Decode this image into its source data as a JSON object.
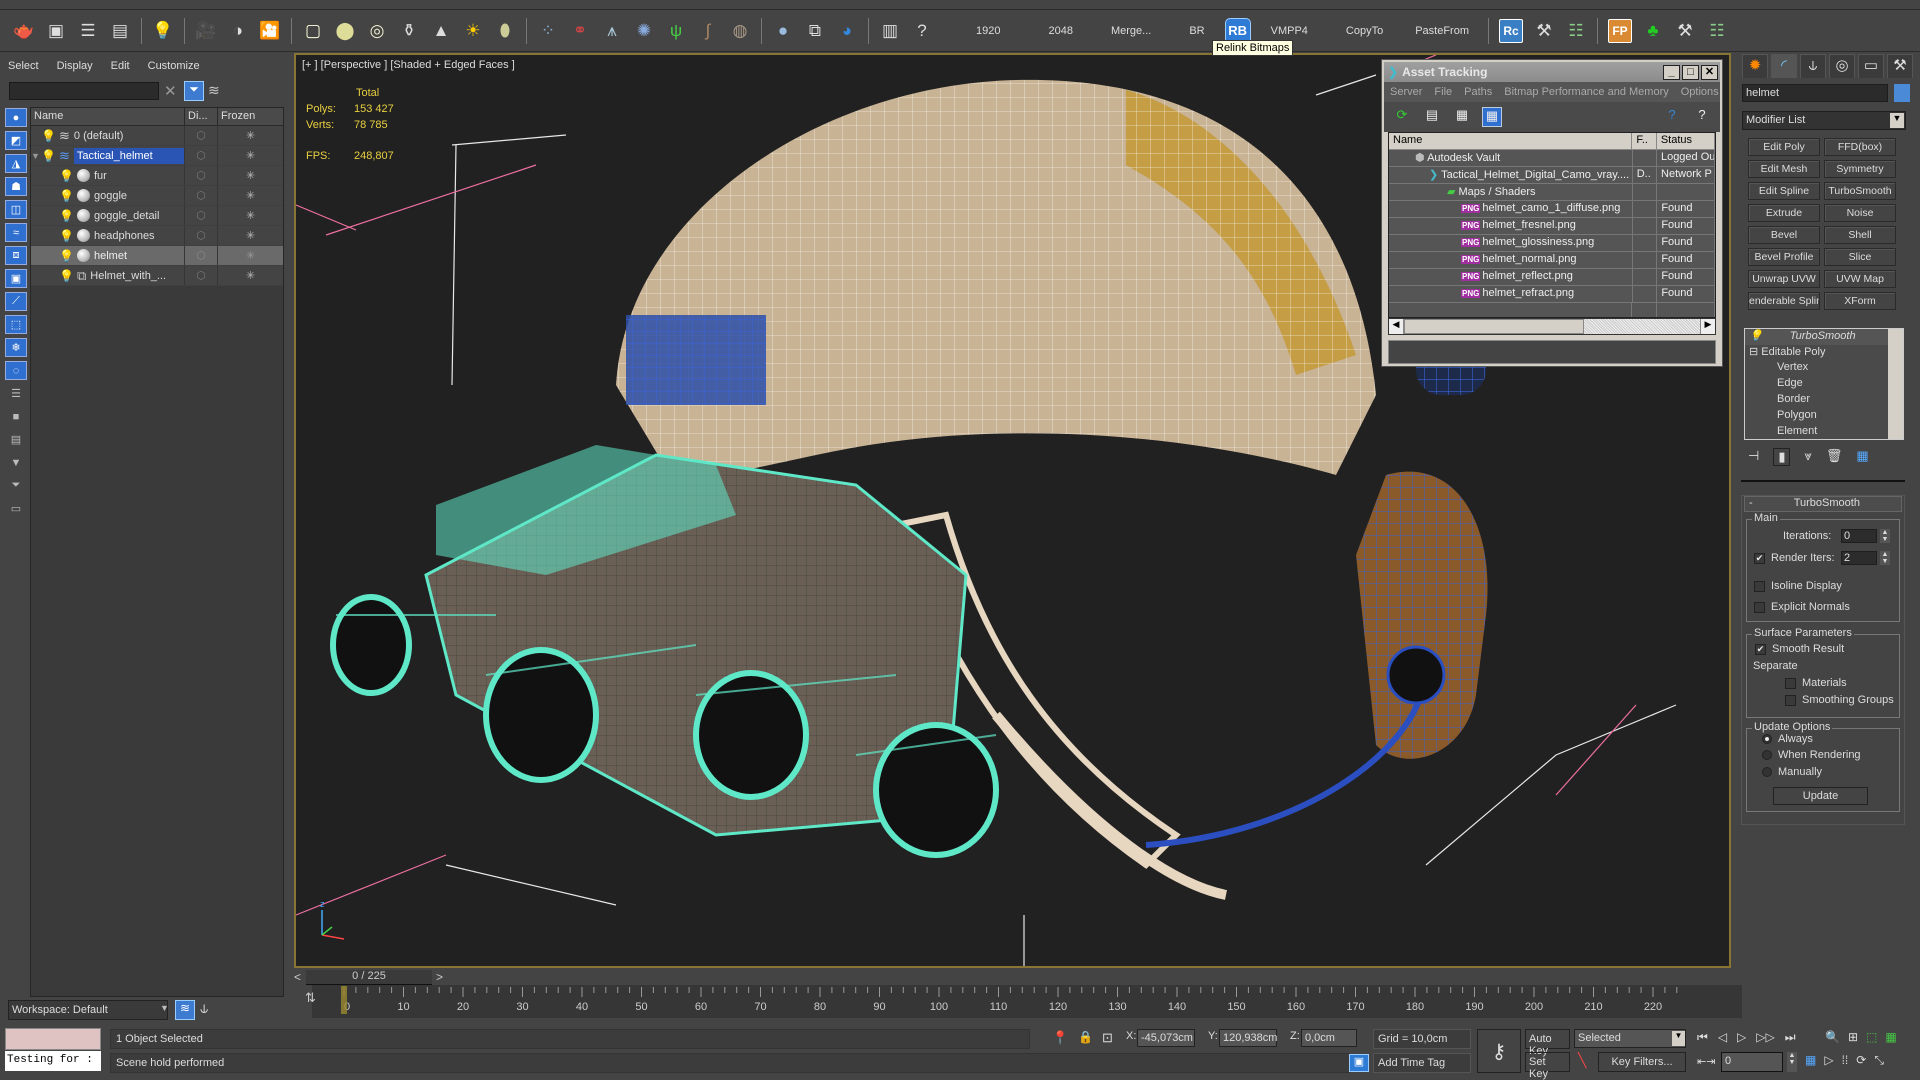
{
  "toolbar": {
    "icons": [
      "teapot-icon",
      "render-frame-icon",
      "render-setup-icon",
      "render-settings-icon",
      "light-lister-icon",
      "camera-icon",
      "camera-target-icon",
      "camera-fx-icon",
      "plane-icon",
      "dome-icon",
      "sphere-light-icon",
      "teapot-wire-icon",
      "cone-icon",
      "sun-icon",
      "egg-icon",
      "particles-icon",
      "molecule-icon",
      "tower-icon",
      "spiky-icon",
      "grass-icon",
      "hair-icon",
      "fur-ball-icon",
      "sphere-icon",
      "material-browser-icon",
      "object-icon",
      "panel-icon",
      "help-icon"
    ],
    "text_buttons": [
      "1920",
      "2048",
      "Merge...",
      "BR"
    ],
    "rb_label": "RB",
    "text_buttons_2": [
      "VMPP4",
      "CopyTo",
      "PasteFrom"
    ],
    "rc_label": "Rc",
    "fp_label": "FP",
    "tooltip": "Relink Bitmaps"
  },
  "explorer": {
    "menu": [
      "Select",
      "Display",
      "Edit",
      "Customize"
    ],
    "search_value": "",
    "columns": [
      "Name",
      "Di...",
      "Frozen"
    ],
    "rows": [
      {
        "name": "0 (default)",
        "type": "layer",
        "indent": 0
      },
      {
        "name": "Tactical_helmet",
        "type": "layer",
        "indent": 0,
        "selected": true
      },
      {
        "name": "fur",
        "type": "object",
        "indent": 1
      },
      {
        "name": "goggle",
        "type": "object",
        "indent": 1
      },
      {
        "name": "goggle_detail",
        "type": "object",
        "indent": 1
      },
      {
        "name": "headphones",
        "type": "object",
        "indent": 1
      },
      {
        "name": "helmet",
        "type": "object",
        "indent": 1,
        "highlighted": true
      },
      {
        "name": "Helmet_with_...",
        "type": "group",
        "indent": 1
      }
    ],
    "workspace": "Workspace: Default"
  },
  "viewport": {
    "label": "[+ ] [Perspective ] [Shaded + Edged Faces ]",
    "stats": {
      "header": "Total",
      "polys_label": "Polys:",
      "polys": "153 427",
      "verts_label": "Verts:",
      "verts": "78 785",
      "fps_label": "FPS:",
      "fps": "248,807"
    }
  },
  "asset_tracking": {
    "title": "Asset Tracking",
    "menu": [
      "Server",
      "File",
      "Paths",
      "Bitmap Performance and Memory",
      "Options"
    ],
    "columns": [
      "Name",
      "F..",
      "Status"
    ],
    "rows": [
      {
        "name": "Autodesk Vault",
        "f": "",
        "status": "Logged Ou",
        "indent": 1,
        "icon": "vault"
      },
      {
        "name": "Tactical_Helmet_Digital_Camo_vray....",
        "f": "D..",
        "status": "Network P",
        "indent": 2,
        "icon": "max"
      },
      {
        "name": "Maps / Shaders",
        "f": "",
        "status": "",
        "indent": 3,
        "icon": "maps"
      },
      {
        "name": "helmet_camo_1_diffuse.png",
        "f": "",
        "status": "Found",
        "indent": 4,
        "icon": "png"
      },
      {
        "name": "helmet_fresnel.png",
        "f": "",
        "status": "Found",
        "indent": 4,
        "icon": "png"
      },
      {
        "name": "helmet_glossiness.png",
        "f": "",
        "status": "Found",
        "indent": 4,
        "icon": "png"
      },
      {
        "name": "helmet_normal.png",
        "f": "",
        "status": "Found",
        "indent": 4,
        "icon": "png"
      },
      {
        "name": "helmet_reflect.png",
        "f": "",
        "status": "Found",
        "indent": 4,
        "icon": "png"
      },
      {
        "name": "helmet_refract.png",
        "f": "",
        "status": "Found",
        "indent": 4,
        "icon": "png"
      }
    ]
  },
  "command_panel": {
    "object_name": "helmet",
    "object_color": "#4a8ad6",
    "modifier_list": "Modifier List",
    "modifier_buttons": [
      "Edit Poly",
      "FFD(box)",
      "Edit Mesh",
      "Symmetry",
      "Edit Spline",
      "TurboSmooth",
      "Extrude",
      "Noise",
      "Bevel",
      "Shell",
      "Bevel Profile",
      "Slice",
      "Unwrap UVW",
      "UVW Map",
      "enderable Splin",
      "XForm"
    ],
    "stack": [
      "TurboSmooth",
      "Editable Poly",
      "Vertex",
      "Edge",
      "Border",
      "Polygon",
      "Element"
    ],
    "rollout": {
      "title": "TurboSmooth",
      "main_label": "Main",
      "iterations_label": "Iterations:",
      "iterations": "0",
      "render_iters_label": "Render Iters:",
      "render_iters": "2",
      "render_iters_checked": true,
      "isoline_label": "Isoline Display",
      "isoline_checked": false,
      "explicit_label": "Explicit Normals",
      "explicit_checked": false,
      "surface_label": "Surface Parameters",
      "smooth_result_label": "Smooth Result",
      "smooth_result_checked": true,
      "separate_label": "Separate",
      "materials_label": "Materials",
      "smoothing_groups_label": "Smoothing Groups",
      "update_label": "Update Options",
      "update_options": [
        "Always",
        "When Rendering",
        "Manually"
      ],
      "update_selected": "Always",
      "update_button": "Update"
    }
  },
  "timeline": {
    "frame_display": "0 / 225",
    "current_frame": 0,
    "total_frames": 225,
    "ticks": [
      "0",
      "10",
      "20",
      "30",
      "40",
      "50",
      "60",
      "70",
      "80",
      "90",
      "100",
      "110",
      "120",
      "130",
      "140",
      "150",
      "160",
      "170",
      "180",
      "190",
      "200",
      "210",
      "220"
    ]
  },
  "status": {
    "maxscript_output": "Testing for :",
    "selection": "1 Object Selected",
    "prompt": "Scene hold performed",
    "x_label": "X:",
    "x": "-45,073cm",
    "y_label": "Y:",
    "y": "120,938cm",
    "z_label": "Z:",
    "z": "0,0cm",
    "grid": "Grid = 10,0cm",
    "add_time_tag": "Add Time Tag",
    "auto_key": "Auto Key",
    "set_key": "Set Key",
    "key_mode": "Selected",
    "key_filters": "Key Filters...",
    "frame": "0"
  }
}
